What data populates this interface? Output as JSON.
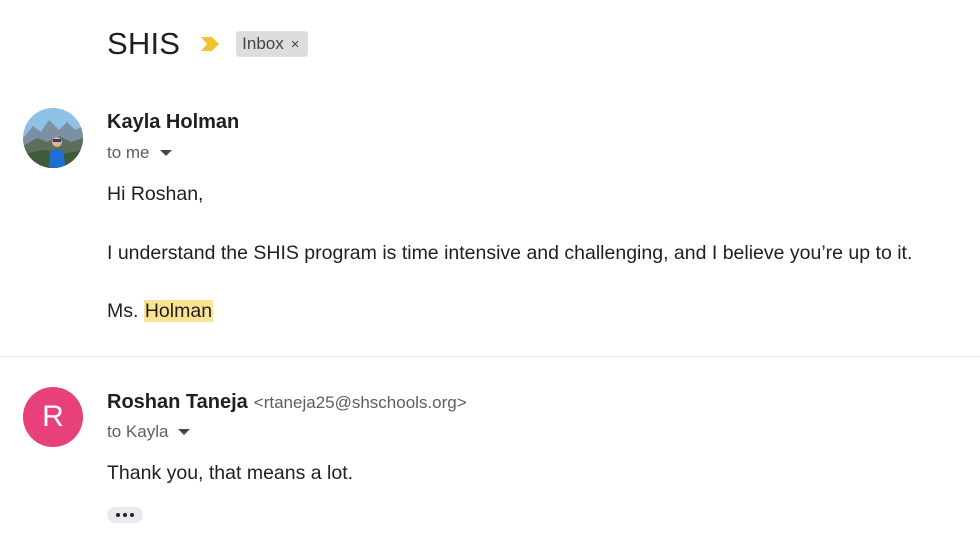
{
  "thread": {
    "subject": "SHIS",
    "label": "Inbox",
    "label_close": "×",
    "importance_color": "#f4c430"
  },
  "messages": [
    {
      "sender_name": "Kayla Holman",
      "to": "to me",
      "body": {
        "greeting": "Hi Roshan,",
        "paragraph": "I understand the SHIS program is time intensive and challenging, and I believe you’re up to it.",
        "signoff_prefix": "Ms. ",
        "signoff_highlight": "Holman"
      }
    },
    {
      "sender_name": "Roshan Taneja",
      "sender_email": "<rtaneja25@shschools.org>",
      "avatar_letter": "R",
      "avatar_color": "#e8407a",
      "to": "to Kayla",
      "body": {
        "text": "Thank you, that means a lot."
      }
    }
  ],
  "icons": {
    "importance": "importance-marker-icon",
    "caret": "caret-down-icon",
    "more": "more-horiz-icon"
  }
}
